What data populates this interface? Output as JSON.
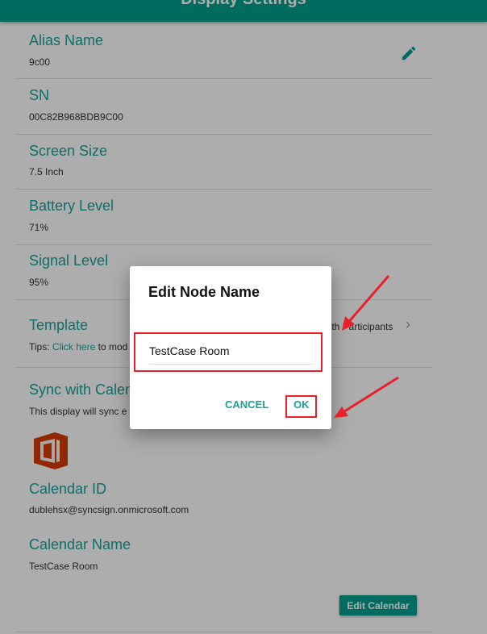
{
  "header": {
    "title": "Display Settings"
  },
  "fields": [
    {
      "label": "Alias Name",
      "value": "9c00"
    },
    {
      "label": "SN",
      "value": "00C82B968BDB9C00"
    },
    {
      "label": "Screen Size",
      "value": "7.5 Inch"
    },
    {
      "label": "Battery Level",
      "value": "71%"
    },
    {
      "label": "Signal Level",
      "value": "95%"
    }
  ],
  "template": {
    "label": "Template",
    "value": "with Participants",
    "tips_prefix": "Tips: ",
    "tips_link": "Click here",
    "tips_suffix": " to mod"
  },
  "sync": {
    "label": "Sync with Calendar",
    "text": "This display will sync e"
  },
  "calendar": {
    "id_label": "Calendar ID",
    "id_value": "dublehsx@syncsign.onmicrosoft.com",
    "name_label": "Calendar Name",
    "name_value": "TestCase Room",
    "edit_button": "Edit Calendar"
  },
  "dialog": {
    "title": "Edit Node Name",
    "input_value": "TestCase Room",
    "cancel": "CANCEL",
    "ok": "OK"
  },
  "colors": {
    "accent": "#00a08c",
    "annotation": "#e8202a"
  }
}
